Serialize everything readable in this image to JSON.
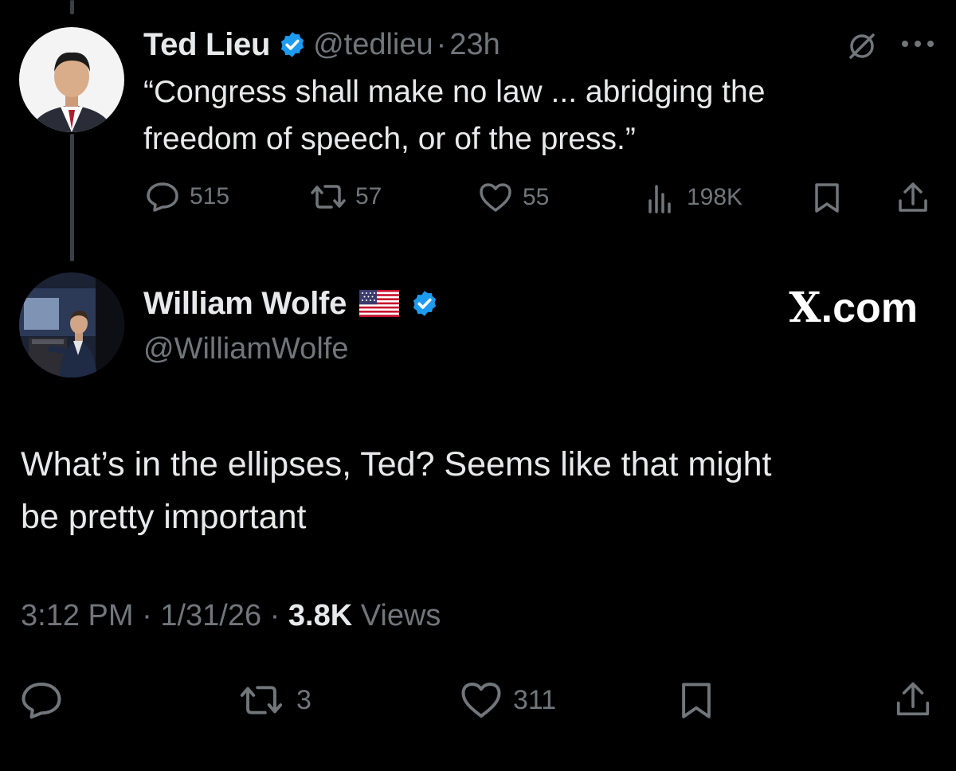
{
  "original_tweet": {
    "author_name": "Ted Lieu",
    "handle": "@tedlieu",
    "separator": "·",
    "time_ago": "23h",
    "text_line1": "“Congress shall make no law ... abridging the",
    "text_line2": "freedom of speech, or of the press.”",
    "replies": "515",
    "reposts": "57",
    "likes": "55",
    "views": "198K",
    "icons": [
      "grok-icon",
      "more-icon",
      "reply-icon",
      "repost-icon",
      "like-icon",
      "views-icon",
      "bookmark-icon",
      "share-icon"
    ]
  },
  "reply_tweet": {
    "author_name": "William Wolfe",
    "flag": "🇺🇸",
    "handle": "@WilliamWolfe",
    "text_line1": "What’s in the ellipses, Ted? Seems like that might",
    "text_line2": "be pretty important",
    "time": "3:12 PM",
    "separator": "·",
    "date": "1/31/26",
    "views_count": "3.8K",
    "views_label": "Views",
    "reposts": "3",
    "likes": "311",
    "icons": [
      "reply-icon",
      "repost-icon",
      "like-icon",
      "bookmark-icon",
      "share-icon"
    ]
  },
  "watermark": {
    "x": "X",
    "domain": ".com"
  },
  "colors": {
    "background": "#000000",
    "text": "#e7e9ea",
    "muted": "#71767b",
    "verified": "#1d9bf0"
  }
}
